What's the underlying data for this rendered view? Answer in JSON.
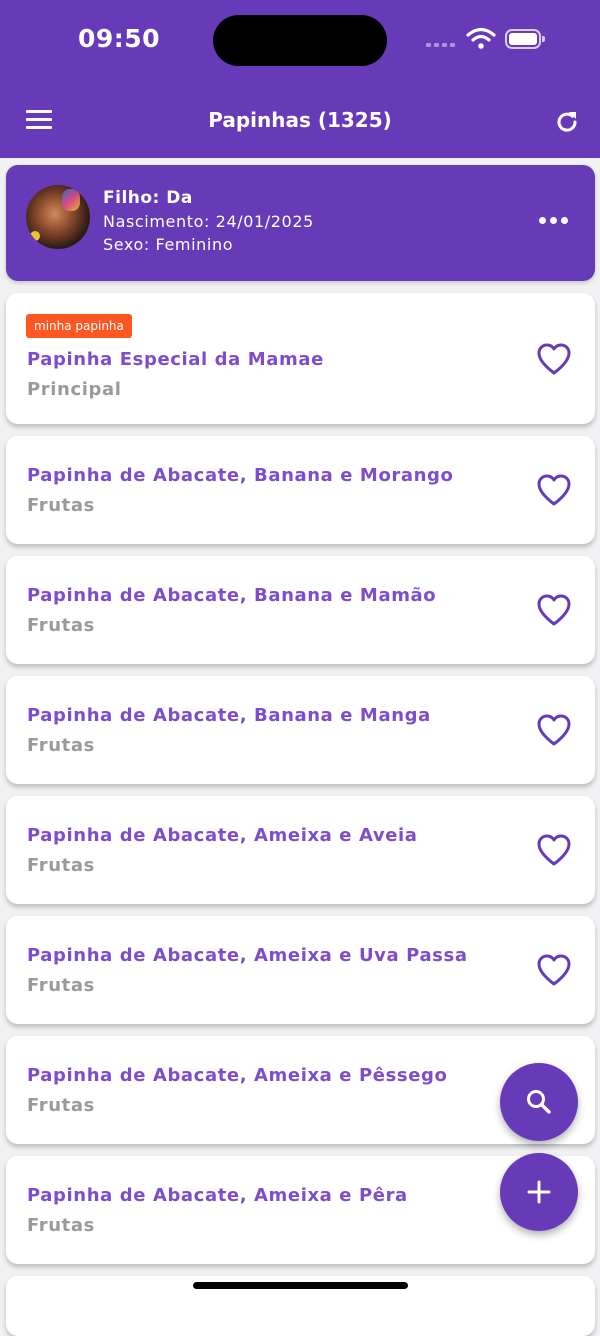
{
  "status_bar": {
    "time": "09:50"
  },
  "app_bar": {
    "title": "Papinhas (1325)"
  },
  "child": {
    "name": "Filho: Da",
    "birth": "Nascimento: 24/01/2025",
    "sex": "Sexo: Feminino"
  },
  "recipes": [
    {
      "badge": "minha papinha",
      "name": "Papinha Especial da Mamae",
      "category": "Principal"
    },
    {
      "name": "Papinha de Abacate, Banana e Morango",
      "category": "Frutas"
    },
    {
      "name": "Papinha de Abacate, Banana e Mamão",
      "category": "Frutas"
    },
    {
      "name": "Papinha de Abacate, Banana e Manga",
      "category": "Frutas"
    },
    {
      "name": "Papinha de Abacate, Ameixa e Aveia",
      "category": "Frutas"
    },
    {
      "name": "Papinha de Abacate, Ameixa e Uva Passa",
      "category": "Frutas"
    },
    {
      "name": "Papinha de Abacate, Ameixa e Pêssego",
      "category": "Frutas"
    },
    {
      "name": "Papinha de Abacate, Ameixa e Pêra",
      "category": "Frutas"
    }
  ],
  "icons": {
    "menu": "menu-icon",
    "refresh": "refresh-icon",
    "more": "more-horizontal-icon",
    "favorite": "heart-outline-icon",
    "search": "search-icon",
    "add": "plus-icon"
  },
  "colors": {
    "primary": "#673ab7",
    "recipe_title": "#7e4dcb",
    "category": "#9a9a9a",
    "badge": "#ff5722",
    "background": "#f1f1f3"
  }
}
